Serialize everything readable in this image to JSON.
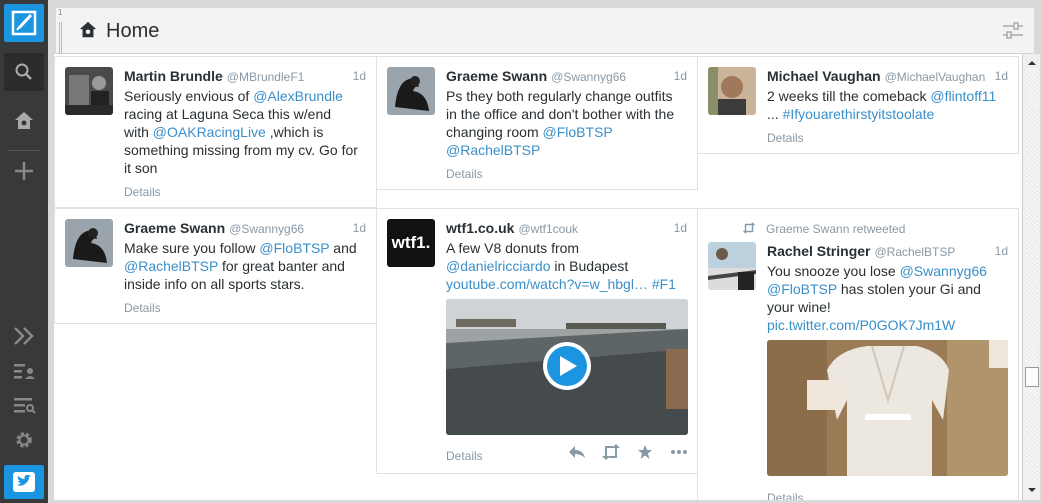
{
  "header": {
    "title": "Home",
    "column_index": "1"
  },
  "sidebar": {
    "items": [
      {
        "icon": "compose-icon"
      },
      {
        "icon": "search-icon"
      },
      {
        "icon": "home-icon"
      },
      {
        "icon": "add-column-icon"
      },
      {
        "icon": "expand-icon"
      },
      {
        "icon": "accounts-icon"
      },
      {
        "icon": "lists-icon"
      },
      {
        "icon": "settings-icon"
      },
      {
        "icon": "twitter-bird-icon"
      }
    ]
  },
  "colors": {
    "accent": "#1b95e0",
    "link": "#3a8fc8",
    "muted": "#8899a6"
  },
  "tweets": [
    {
      "name": "Martin Brundle",
      "handle": "@MBrundleF1",
      "time": "1d",
      "t1": "Seriously envious of ",
      "l1": "@AlexBrundle",
      "t2": "racing at Laguna Seca this w/end",
      "t3": "with ",
      "l2": "@OAKRacingLive",
      "t4": " ,which is",
      "t5": "something missing from my cv. Go for",
      "t6": "it son",
      "details": "Details"
    },
    {
      "name": "Graeme Swann",
      "handle": "@Swannyg66",
      "time": "1d",
      "t1": "Ps they both regularly change outfits",
      "t2": "in the office and don't bother with the",
      "t3": "changing room ",
      "l1": "@FloBTSP",
      "l2": "@RachelBTSP",
      "details": "Details"
    },
    {
      "name": "Michael Vaughan",
      "handle": "@MichaelVaughan",
      "time": "1d",
      "t1": "2 weeks till the comeback ",
      "l1": "@flintoff11",
      "t2": "... ",
      "l2": "#Ifyouarethirstyitstoolate",
      "details": "Details"
    },
    {
      "name": "Graeme Swann",
      "handle": "@Swannyg66",
      "time": "1d",
      "t1": "Make sure you follow ",
      "l1": "@FloBTSP",
      "t2": " and",
      "l2": "@RachelBTSP",
      "t3": " for great banter and",
      "t4": "inside info on all sports stars.",
      "details": "Details"
    },
    {
      "name": "wtf1.co.uk",
      "handle": "@wtf1couk",
      "time": "1d",
      "t1": "A few V8 donuts from",
      "l1": "@danielricciardo",
      "t2": " in Budapest",
      "l2": "youtube.com/watch?v=w_hbgl…",
      "l3": "#F1",
      "avatar_text": "wtf1.",
      "details": "Details"
    },
    {
      "retweeted_by": "Graeme Swann retweeted",
      "name": "Rachel Stringer",
      "handle": "@RachelBTSP",
      "time": "1d",
      "t1": "You snooze you lose ",
      "l1": "@Swannyg66",
      "l2": "@FloBTSP",
      "t2": " has stolen your Gi and",
      "t3": "your wine!",
      "l3": "pic.twitter.com/P0GOK7Jm1W",
      "details": "Details"
    }
  ]
}
